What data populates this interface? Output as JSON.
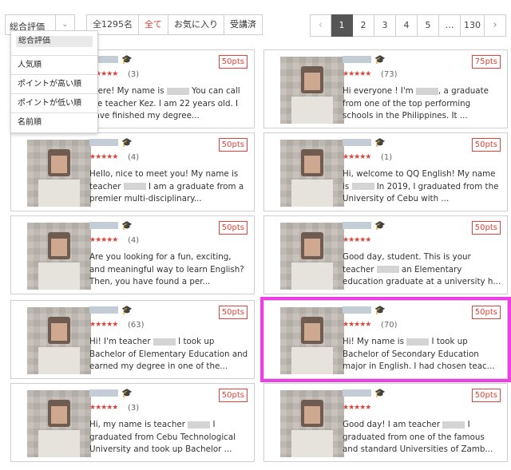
{
  "toolbar": {
    "sort_selected": "総合評価",
    "sort_arrow": "⌄",
    "filters": [
      "全1295名",
      "全て",
      "お気に入り",
      "受講済"
    ],
    "pagination": [
      "‹",
      "1",
      "2",
      "3",
      "4",
      "5",
      "…",
      "130",
      "›"
    ],
    "active_page": "1"
  },
  "dropdown": {
    "selected": "総合評価",
    "options": [
      "人気順",
      "ポイントが高い順",
      "ポイントが低い順",
      "名前順"
    ]
  },
  "colors": {
    "accent": "#e0433b",
    "highlight": "#ee3fe7",
    "active_page_bg": "#555555"
  },
  "icons": {
    "graduation": "graduation-cap-icon",
    "star": "star-icon"
  },
  "teachers": [
    {
      "points": "50pts",
      "stars": "★★★★★",
      "count": "(3)",
      "desc": "there! My name is ░░ You can call me teacher Kez. I am 22 years old. I have finished my degree..."
    },
    {
      "points": "75pts",
      "stars": "★★★★★",
      "count": "(73)",
      "desc": "Hi everyone ! I'm ░░, a graduate from one of the top performing schools in the Philippines. It ..."
    },
    {
      "points": "50pts",
      "stars": "★★★★★",
      "count": "(4)",
      "desc": "Hello, nice to meet you! My name is teacher ░░ I am a graduate from a premier multi-disciplinary..."
    },
    {
      "points": "50pts",
      "stars": "★★★★★",
      "count": "(1)",
      "desc": "Hi, welcome to QQ English! My name is ░░ In 2019, I graduated from the University of Cebu with ..."
    },
    {
      "points": "50pts",
      "stars": "★★★★★",
      "count": "(4)",
      "desc": "Are you looking for a fun, exciting, and meaningful way to learn English? Then, you have found a per..."
    },
    {
      "points": "50pts",
      "stars": "★★★★★",
      "count": "",
      "desc": "Good day, student. This is your teacher ░░ an Elementary education graduate at a university h..."
    },
    {
      "points": "50pts",
      "stars": "★★★★★",
      "count": "(63)",
      "desc": "Hi! I'm teacher ░░ I took up Bachelor of Elementary Education and earned my degree in one of the..."
    },
    {
      "points": "50pts",
      "stars": "★★★★★",
      "count": "(70)",
      "desc": "Hi! My name is ░░ I took up Bachelor of Secondary Education major in English. I had chosen teac..."
    },
    {
      "points": "50pts",
      "stars": "★★★★★",
      "count": "(3)",
      "desc": "Hi, my name is teacher ░░ I graduated from Cebu Technological University and took up Bachelor ..."
    },
    {
      "points": "50pts",
      "stars": "★★★★★",
      "count": "",
      "desc": "Good day! I am teacher ░░ I graduated from one of the famous and standard Universities of Zamb..."
    }
  ]
}
